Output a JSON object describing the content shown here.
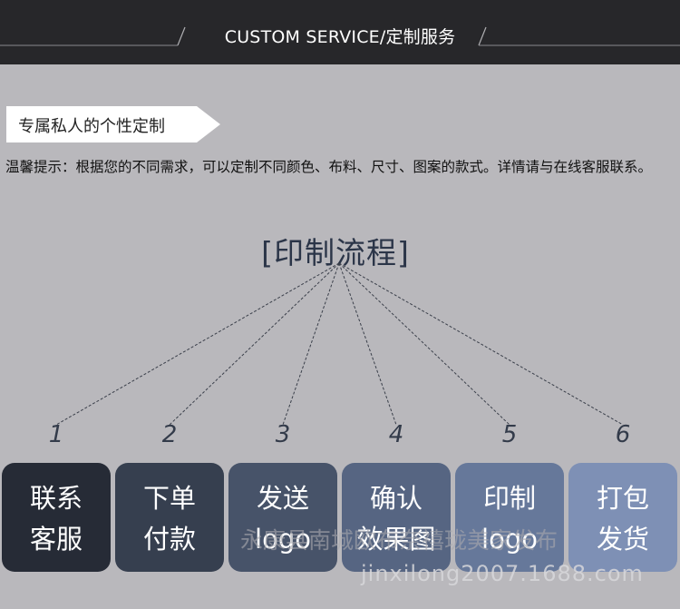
{
  "header": {
    "title": "CUSTOM SERVICE/定制服务"
  },
  "banner": {
    "label": "专属私人的个性定制"
  },
  "notice": {
    "text": "温馨提示：根据您的不同需求，可以定制不同颜色、布料、尺寸、图案的款式。详情请与在线客服联系。"
  },
  "process": {
    "title": "[印制流程]",
    "steps": [
      {
        "num": "1",
        "line1": "联系",
        "line2": "客服",
        "color": "#262b36"
      },
      {
        "num": "2",
        "line1": "下单",
        "line2": "付款",
        "color": "#363f4f"
      },
      {
        "num": "3",
        "line1": "发送",
        "line2": "logo",
        "color": "#475369"
      },
      {
        "num": "4",
        "line1": "确认",
        "line2": "效果图",
        "color": "#566582"
      },
      {
        "num": "5",
        "line1": "印制",
        "line2": "logo",
        "color": "#66789a"
      },
      {
        "num": "6",
        "line1": "打包",
        "line2": "发货",
        "color": "#7e90b5"
      }
    ]
  },
  "watermark": {
    "text": "永康县南城欧布奈禧珑美家发布",
    "url": "jinxilong2007.1688.com"
  }
}
